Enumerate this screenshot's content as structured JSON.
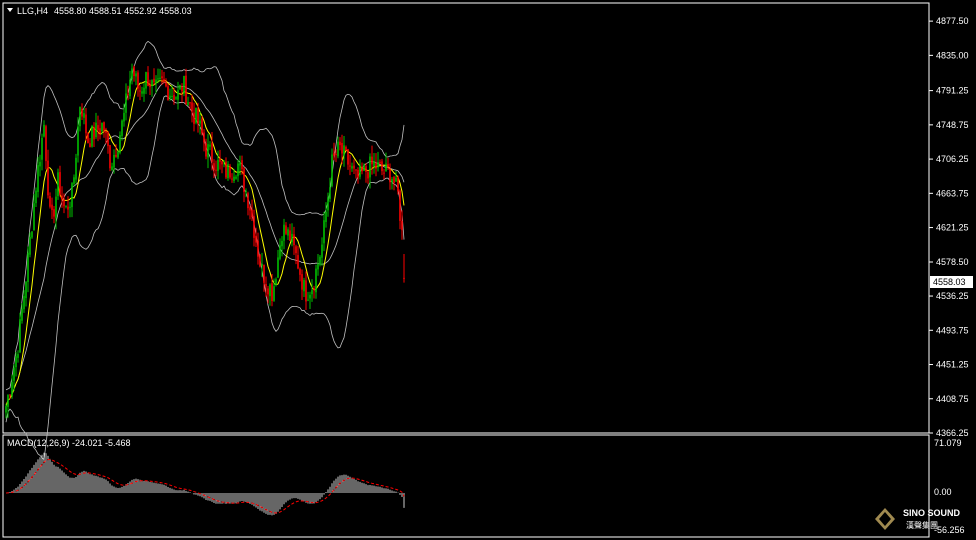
{
  "header": {
    "symbol_tf": "LLG,H4",
    "ohlc": "4558.80 4588.51 4552.92 4558.03"
  },
  "price_axis": {
    "ticks": [
      "4877.50",
      "4835.00",
      "4791.25",
      "4748.75",
      "4706.25",
      "4663.75",
      "4621.25",
      "4578.50",
      "4536.25",
      "4493.75",
      "4451.25",
      "4408.75",
      "4366.25"
    ],
    "current_label": "4558.03"
  },
  "macd": {
    "label": "MACD(12,26,9) -24.021 -5.468",
    "ticks": [
      "71.079",
      "0.00",
      "-56.256"
    ]
  },
  "logo": {
    "name": "SINO SOUND",
    "cn": "漢聲集團"
  },
  "colors": {
    "bull": "#00c000",
    "bear": "#ff0000",
    "band": "#c0c0c0",
    "ma": "#ffff00",
    "signal": "#ff0000",
    "hist": "#ffffff"
  },
  "chart_data": [
    {
      "type": "candlestick",
      "title": "LLG,H4",
      "ylim": [
        4366.25,
        4900
      ],
      "overlays": [
        "Bollinger Bands (upper, middle, lower)",
        "moving average (yellow)"
      ],
      "bars": 200,
      "price_path_anchors": [
        [
          0,
          4400
        ],
        [
          12,
          4470
        ],
        [
          22,
          4570
        ],
        [
          32,
          4680
        ],
        [
          40,
          4750
        ],
        [
          47,
          4620
        ],
        [
          55,
          4680
        ],
        [
          62,
          4640
        ],
        [
          70,
          4665
        ],
        [
          78,
          4780
        ],
        [
          86,
          4730
        ],
        [
          94,
          4740
        ],
        [
          102,
          4750
        ],
        [
          110,
          4700
        ],
        [
          118,
          4730
        ],
        [
          124,
          4760
        ],
        [
          132,
          4820
        ],
        [
          140,
          4790
        ],
        [
          148,
          4810
        ],
        [
          156,
          4790
        ],
        [
          164,
          4800
        ],
        [
          172,
          4790
        ],
        [
          180,
          4785
        ],
        [
          186,
          4800
        ],
        [
          194,
          4770
        ],
        [
          202,
          4750
        ],
        [
          210,
          4720
        ],
        [
          222,
          4700
        ],
        [
          232,
          4690
        ],
        [
          244,
          4700
        ],
        [
          256,
          4650
        ],
        [
          268,
          4570
        ],
        [
          280,
          4540
        ],
        [
          290,
          4620
        ],
        [
          298,
          4610
        ],
        [
          306,
          4580
        ],
        [
          314,
          4540
        ],
        [
          322,
          4550
        ],
        [
          332,
          4600
        ],
        [
          342,
          4700
        ],
        [
          350,
          4720
        ],
        [
          360,
          4700
        ],
        [
          368,
          4680
        ],
        [
          376,
          4690
        ],
        [
          386,
          4700
        ],
        [
          396,
          4690
        ],
        [
          404,
          4690
        ],
        [
          412,
          4660
        ],
        [
          420,
          4562
        ]
      ],
      "last": {
        "open": 4558.8,
        "high": 4588.51,
        "low": 4552.92,
        "close": 4558.03
      }
    },
    {
      "type": "bar",
      "title": "MACD(12,26,9)",
      "series": [
        {
          "name": "MACD",
          "values_desc": "histogram"
        },
        {
          "name": "Signal",
          "values_desc": "dashed line"
        }
      ],
      "main": -24.021,
      "signal": -5.468,
      "ylim": [
        -56.256,
        71.079
      ]
    }
  ]
}
